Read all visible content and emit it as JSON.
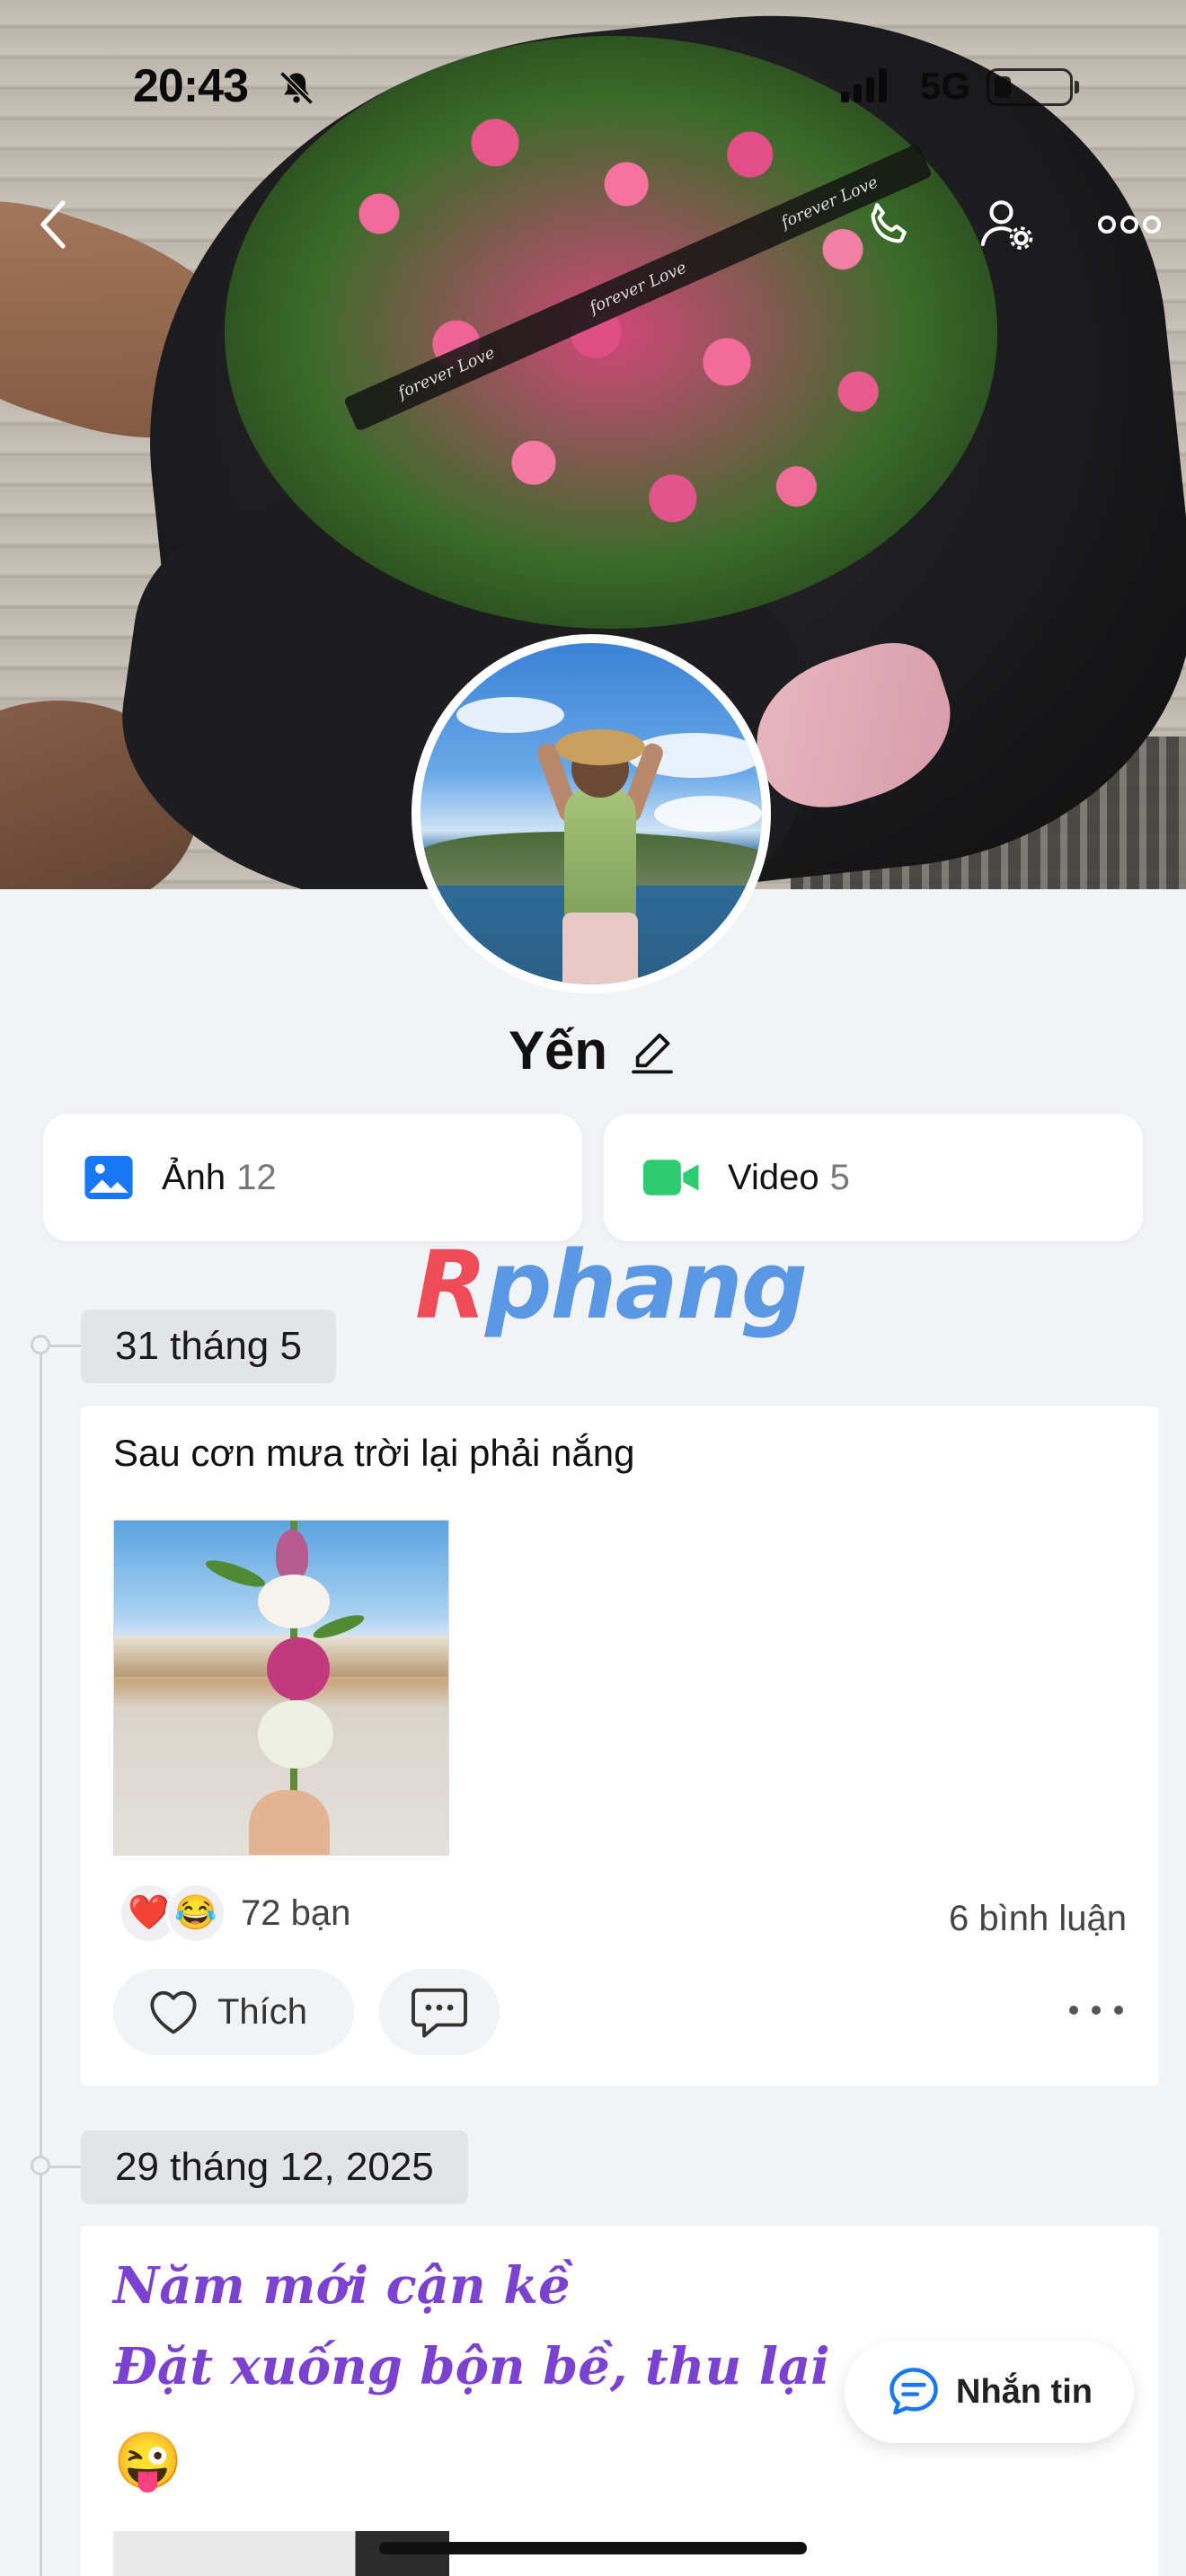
{
  "status_bar": {
    "time": "20:43",
    "network": "5G"
  },
  "profile": {
    "name": "Yến"
  },
  "media": {
    "photos": {
      "label": "Ảnh",
      "count": "12"
    },
    "videos": {
      "label": "Video",
      "count": "5"
    }
  },
  "watermark": "Rphang",
  "cover": {
    "ribbon_text": "forever Love"
  },
  "timeline": [
    {
      "date": "31 tháng 5",
      "text": "Sau cơn mưa trời lại phải nắng",
      "reactions": {
        "emojis": [
          "❤️",
          "😂"
        ],
        "count_label": "72 bạn"
      },
      "comments_label": "6 bình luận",
      "like_label": "Thích"
    },
    {
      "date": "29 tháng 12, 2025",
      "lines": [
        "Năm mới cận kề",
        "Đặt xuống bộn bề, thu lại an nhiên"
      ],
      "emoji": "😜"
    }
  ],
  "message_button": {
    "label": "Nhắn tin"
  },
  "colors": {
    "accent_blue": "#1877f2",
    "video_green": "#2ecc71",
    "post_purple": "#7b42d1",
    "heart_red": "#e53935"
  },
  "icons": [
    "back-icon",
    "phone-icon",
    "user-settings-icon",
    "more-icon",
    "image-icon",
    "video-camera-icon",
    "edit-pencil-icon",
    "heart-icon",
    "comment-icon",
    "message-icon",
    "bell-off-icon"
  ]
}
